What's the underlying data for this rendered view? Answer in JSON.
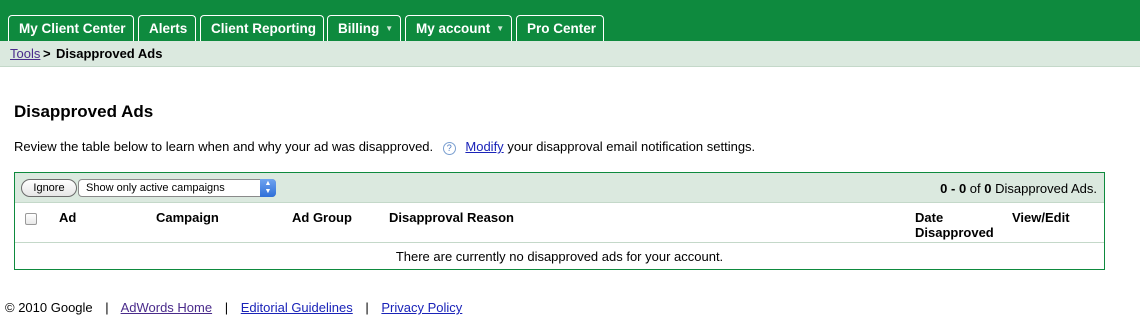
{
  "nav": {
    "tabs": [
      {
        "label": "My Client Center",
        "has_menu": false
      },
      {
        "label": "Alerts",
        "has_menu": false
      },
      {
        "label": "Client Reporting",
        "has_menu": false
      },
      {
        "label": "Billing",
        "has_menu": true
      },
      {
        "label": "My account",
        "has_menu": true
      },
      {
        "label": "Pro Center",
        "has_menu": false
      }
    ],
    "menu_caret": "▼"
  },
  "breadcrumb": {
    "link": "Tools",
    "separator": ">",
    "current": "Disapproved Ads"
  },
  "page": {
    "title": "Disapproved Ads",
    "intro_text": "Review the table below to learn when and why your ad was disapproved.",
    "help_icon": "question-circle-icon",
    "help_glyph": "?",
    "modify_link": "Modify",
    "intro_suffix": "your disapproval email notification settings."
  },
  "table": {
    "ignore_label": "Ignore",
    "filter_selected": "Show only active campaigns",
    "count": {
      "from": "0",
      "dash": " - ",
      "to": "0",
      "of": " of ",
      "total": "0",
      "suffix": " Disapproved Ads."
    },
    "columns": {
      "ad": "Ad",
      "campaign": "Campaign",
      "ad_group": "Ad Group",
      "reason": "Disapproval Reason",
      "date_line1": "Date",
      "date_line2": "Disapproved",
      "view_edit": "View/Edit"
    },
    "empty_message": "There are currently no disapproved ads for your account."
  },
  "footer": {
    "copyright": "© 2010 Google",
    "separator": "|",
    "links": [
      "AdWords Home",
      "Editorial Guidelines",
      "Privacy Policy"
    ]
  },
  "colors": {
    "nav_green": "#0e8a3e",
    "bar_green": "#dbe9df",
    "link_blue": "#1a23b8",
    "link_visited": "#4a2b8b"
  }
}
